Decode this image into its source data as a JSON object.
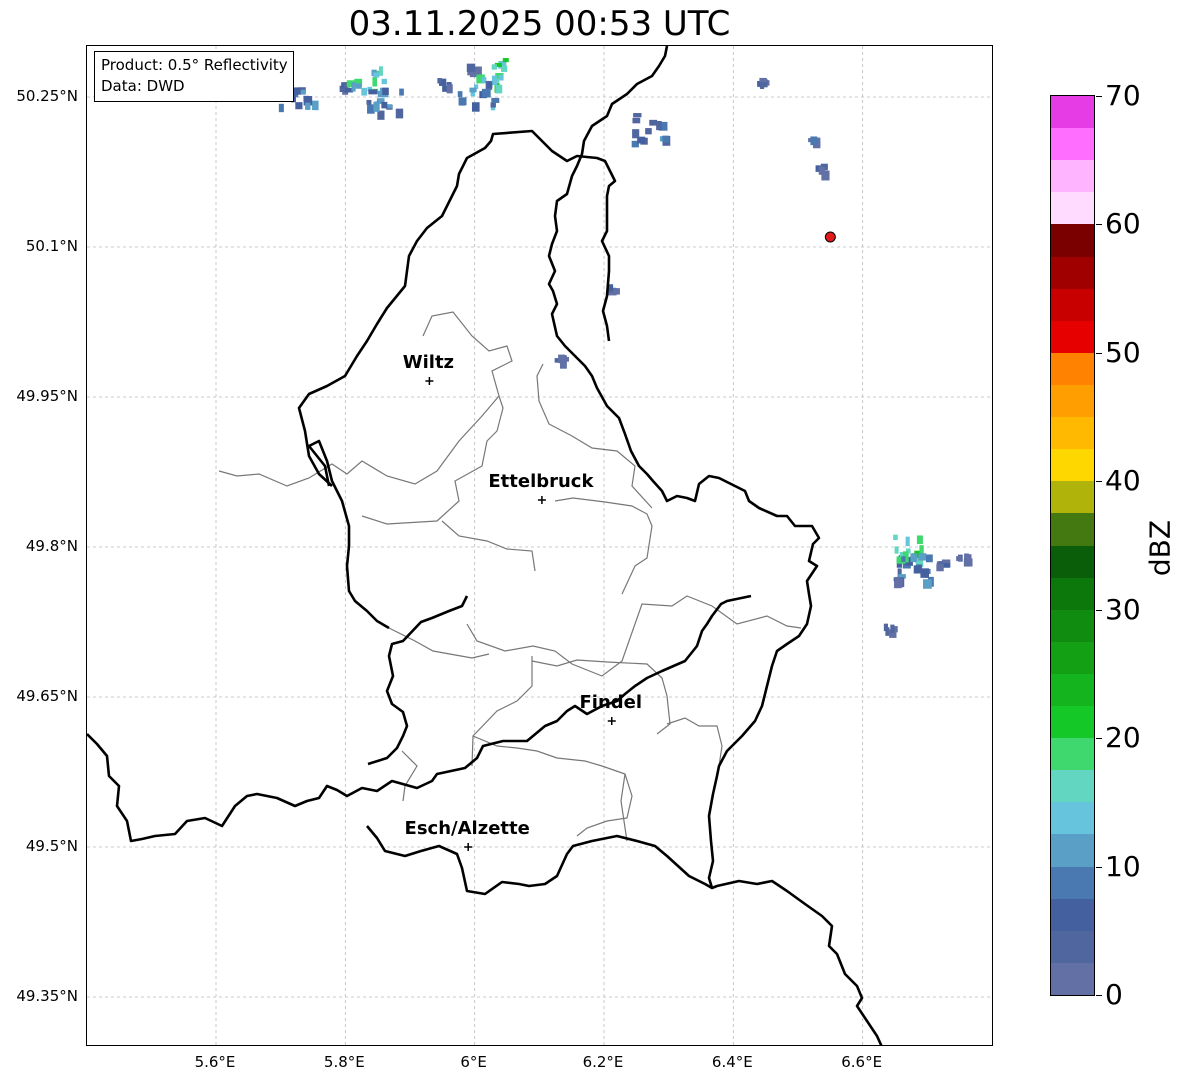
{
  "title": "03.11.2025 00:53 UTC",
  "info": {
    "product": "Product: 0.5° Reflectivity",
    "source": "Data: DWD"
  },
  "cities": [
    {
      "name": "Wiltz",
      "lon": 5.93,
      "lat": 49.966
    },
    {
      "name": "Ettelbruck",
      "lon": 6.104,
      "lat": 49.847
    },
    {
      "name": "Findel",
      "lon": 6.212,
      "lat": 49.626
    },
    {
      "name": "Esch/Alzette",
      "lon": 5.99,
      "lat": 49.5
    }
  ],
  "marker": {
    "lon": 6.55,
    "lat": 50.11,
    "color": "#e31a1c"
  },
  "lat_ticks": [
    "50.25°N",
    "50.1°N",
    "49.95°N",
    "49.8°N",
    "49.65°N",
    "49.5°N",
    "49.35°N"
  ],
  "lon_ticks": [
    "5.6°E",
    "5.8°E",
    "6°E",
    "6.2°E",
    "6.4°E",
    "6.6°E"
  ],
  "colorbar": {
    "unit": "dBZ",
    "min": 0,
    "max": 70,
    "tick_labels": [
      "0",
      "10",
      "20",
      "30",
      "40",
      "50",
      "60",
      "70"
    ],
    "colors": [
      "#6270a6",
      "#50669f",
      "#44609f",
      "#4a78b0",
      "#5a9fc6",
      "#66c4dc",
      "#62d6c0",
      "#3ed86e",
      "#14c828",
      "#14b41e",
      "#14a014",
      "#108c10",
      "#0c780c",
      "#0a5e0a",
      "#447810",
      "#b0b40a",
      "#ffd700",
      "#ffb900",
      "#ff9e00",
      "#ff8200",
      "#e60000",
      "#c80000",
      "#a00000",
      "#7a0000",
      "#ffdcff",
      "#ffb4ff",
      "#ff6eff",
      "#e63ce6"
    ]
  },
  "echo_clusters": [
    {
      "lon": 5.725,
      "lat": 50.255,
      "dbz": 12
    },
    {
      "lon": 5.795,
      "lat": 50.262,
      "dbz": 8
    },
    {
      "lon": 5.83,
      "lat": 50.27,
      "dbz": 20
    },
    {
      "lon": 5.86,
      "lat": 50.25,
      "dbz": 14
    },
    {
      "lon": 5.95,
      "lat": 50.265,
      "dbz": 8
    },
    {
      "lon": 5.99,
      "lat": 50.28,
      "dbz": 6
    },
    {
      "lon": 6.02,
      "lat": 50.275,
      "dbz": 22
    },
    {
      "lon": 6.0,
      "lat": 50.255,
      "dbz": 14
    },
    {
      "lon": 6.27,
      "lat": 50.22,
      "dbz": 12
    },
    {
      "lon": 6.21,
      "lat": 50.06,
      "dbz": 6
    },
    {
      "lon": 6.13,
      "lat": 49.99,
      "dbz": 8
    },
    {
      "lon": 6.44,
      "lat": 50.27,
      "dbz": 6
    },
    {
      "lon": 6.52,
      "lat": 50.21,
      "dbz": 8
    },
    {
      "lon": 6.53,
      "lat": 50.18,
      "dbz": 6
    },
    {
      "lon": 6.66,
      "lat": 49.79,
      "dbz": 8
    },
    {
      "lon": 6.67,
      "lat": 49.8,
      "dbz": 22
    },
    {
      "lon": 6.68,
      "lat": 49.78,
      "dbz": 14
    },
    {
      "lon": 6.72,
      "lat": 49.785,
      "dbz": 6
    },
    {
      "lon": 6.75,
      "lat": 49.79,
      "dbz": 4
    },
    {
      "lon": 6.65,
      "lat": 49.77,
      "dbz": 4
    },
    {
      "lon": 6.64,
      "lat": 49.72,
      "dbz": 4
    }
  ]
}
